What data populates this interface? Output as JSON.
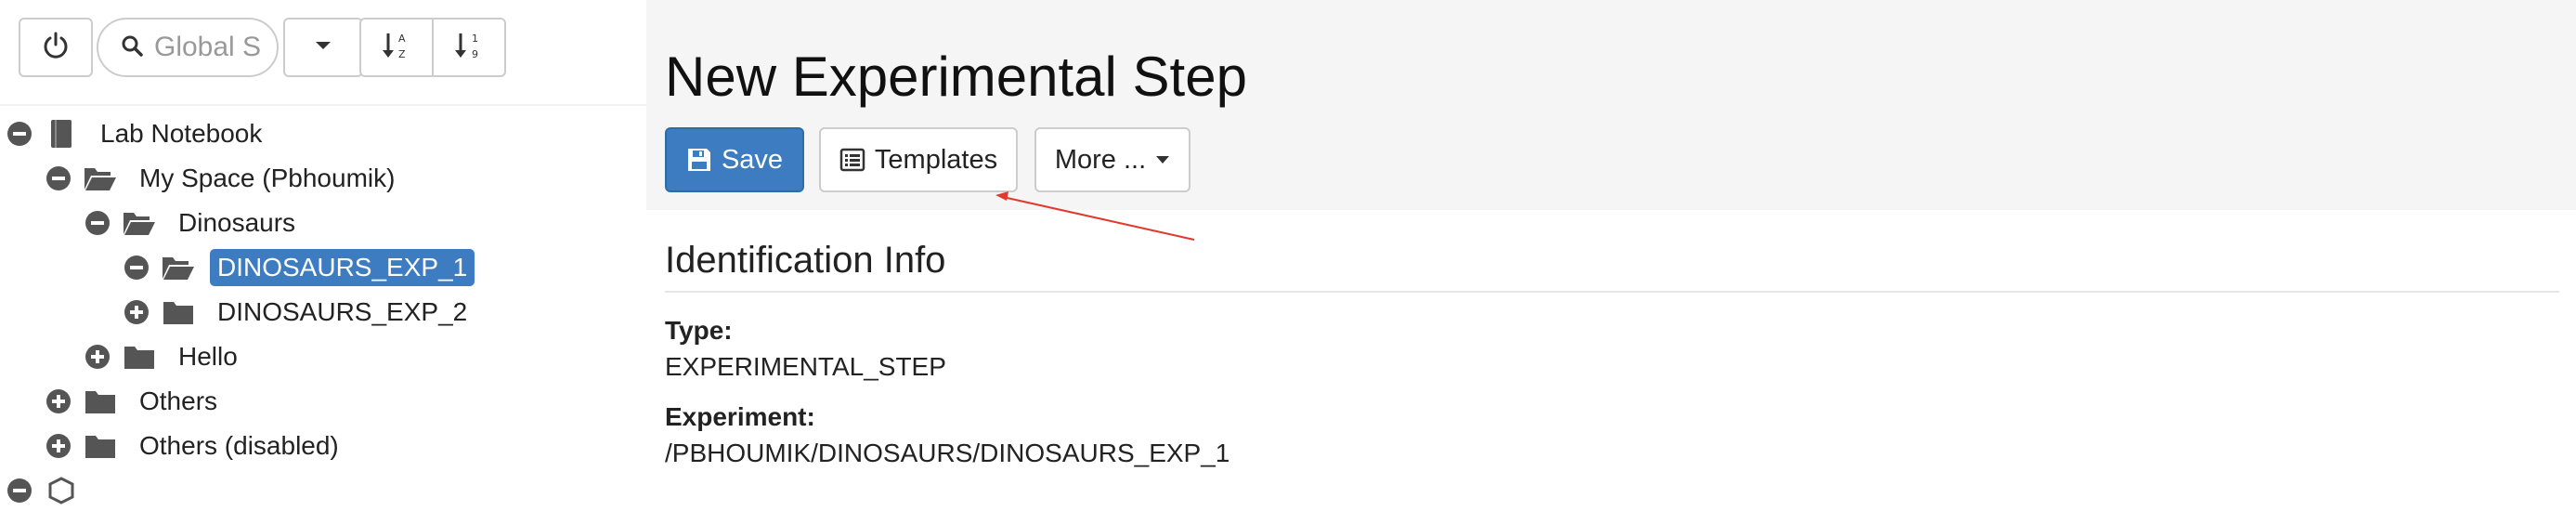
{
  "toolbar": {
    "power_icon": "power-icon",
    "search_placeholder": "Global S",
    "search_icon": "search-icon",
    "dropdown_icon": "caret-down-icon",
    "sort_alpha_icon": "sort-alpha-icon",
    "sort_numeric_icon": "sort-numeric-icon"
  },
  "tree": {
    "items": [
      {
        "label": "Lab Notebook",
        "icon": "notebook-icon",
        "toggle": "collapse"
      },
      {
        "label": "My Space (Pbhoumik)",
        "icon": "folder-open-icon",
        "toggle": "collapse"
      },
      {
        "label": "Dinosaurs",
        "icon": "folder-open-icon",
        "toggle": "collapse"
      },
      {
        "label": "DINOSAURS_EXP_1",
        "icon": "folder-open-icon",
        "toggle": "collapse",
        "selected": true
      },
      {
        "label": "DINOSAURS_EXP_2",
        "icon": "folder-icon",
        "toggle": "expand"
      },
      {
        "label": "Hello",
        "icon": "folder-icon",
        "toggle": "expand"
      },
      {
        "label": "Others",
        "icon": "folder-icon",
        "toggle": "expand"
      },
      {
        "label": "Others (disabled)",
        "icon": "folder-icon",
        "toggle": "expand"
      }
    ]
  },
  "main": {
    "title": "New Experimental Step",
    "buttons": {
      "save": "Save",
      "templates": "Templates",
      "more": "More ..."
    },
    "section": {
      "title": "Identification Info",
      "fields": [
        {
          "label": "Type:",
          "value": "EXPERIMENTAL_STEP"
        },
        {
          "label": "Experiment:",
          "value": "/PBHOUMIK/DINOSAURS/DINOSAURS_EXP_1"
        }
      ]
    }
  },
  "colors": {
    "primary": "#3d7cc1",
    "annotation_arrow": "#e0392d",
    "header_bg": "#f5f5f5"
  }
}
